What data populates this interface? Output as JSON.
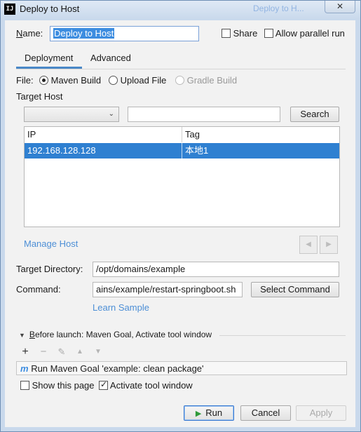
{
  "window": {
    "title": "Deploy to Host",
    "ghost_title": "Deploy to H...",
    "close_symbol": "✕"
  },
  "form": {
    "name_label": "Name:",
    "name_label_mnemonic": "N",
    "name_label_rest": "ame:",
    "name_value": "Deploy to Host",
    "share_label": "Share",
    "share_checked": false,
    "parallel_label": "Allow parallel run",
    "parallel_checked": false
  },
  "tabs": [
    {
      "label": "Deployment",
      "active": true
    },
    {
      "label": "Advanced",
      "active": false
    }
  ],
  "deployment": {
    "file_label": "File:",
    "file_options": [
      {
        "label": "Maven Build",
        "selected": true,
        "enabled": true
      },
      {
        "label": "Upload File",
        "selected": false,
        "enabled": true
      },
      {
        "label": "Gradle Build",
        "selected": false,
        "enabled": false
      }
    ],
    "target_host_label": "Target Host",
    "host_combo_value": "",
    "search_value": "",
    "search_button": "Search",
    "table": {
      "columns": [
        "IP",
        "Tag"
      ],
      "rows": [
        {
          "ip": "192.168.128.128",
          "tag": "本地1",
          "selected": true
        }
      ]
    },
    "manage_host_link": "Manage Host",
    "prev_symbol": "◀",
    "next_symbol": "▶",
    "target_directory_label": "Target Directory:",
    "target_directory_value": "/opt/domains/example",
    "command_label": "Command:",
    "command_value": "ains/example/restart-springboot.sh",
    "select_command_button": "Select Command",
    "learn_sample_link": "Learn Sample"
  },
  "before_launch": {
    "header": "Before launch: Maven Goal, Activate tool window",
    "header_mnemonic": "B",
    "header_rest": "efore launch: Maven Goal, Activate tool window",
    "toolbar": {
      "add": "+",
      "remove": "−",
      "edit": "✎",
      "up": "▲",
      "down": "▼"
    },
    "items": [
      {
        "icon": "m",
        "label": "Run Maven Goal 'example: clean package'"
      }
    ],
    "show_page_label": "Show this page",
    "show_page_checked": false,
    "activate_label": "Activate tool window",
    "activate_checked": true
  },
  "buttons": {
    "run": "Run",
    "cancel": "Cancel",
    "apply": "Apply"
  },
  "colors": {
    "accent": "#4a88c7",
    "selection": "#2f80d1",
    "link": "#4d8fd6",
    "run_icon": "#2e9a3a"
  }
}
